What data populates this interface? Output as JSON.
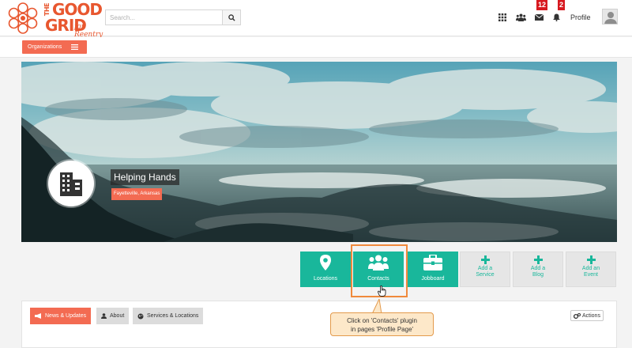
{
  "header": {
    "logo": {
      "line_the": "THE",
      "line_good": "GOOD",
      "line_grid": "GRID",
      "tagline": "for Reentry"
    },
    "search": {
      "placeholder": "Search..."
    },
    "icons": [
      "search-icon",
      "grid-apps-icon",
      "users-icon",
      "envelope-icon",
      "bell-icon"
    ],
    "messages_badge": "12",
    "notifications_badge": "2",
    "profile_label": "Profile"
  },
  "orgbar": {
    "button_label": "Organizations"
  },
  "hero": {
    "org_name": "Helping Hands",
    "org_location": "Fayetteville, Arkansas"
  },
  "plugins": [
    {
      "label": "Locations",
      "icon": "map-marker-icon",
      "style": "green"
    },
    {
      "label": "Contacts",
      "icon": "users-icon",
      "style": "green"
    },
    {
      "label": "Jobboard",
      "icon": "briefcase-icon",
      "style": "green"
    },
    {
      "label_line1": "Add a",
      "label_line2": "Service",
      "icon": "plus-icon",
      "style": "grey"
    },
    {
      "label_line1": "Add a",
      "label_line2": "Blog",
      "icon": "plus-icon",
      "style": "grey"
    },
    {
      "label_line1": "Add an",
      "label_line2": "Event",
      "icon": "plus-icon",
      "style": "grey"
    }
  ],
  "tabs": [
    {
      "label": "News & Updates",
      "icon": "bullhorn-icon",
      "active": true
    },
    {
      "label": "About",
      "icon": "user-icon",
      "active": false
    },
    {
      "label": "Services & Locations",
      "icon": "globe-icon",
      "active": false
    }
  ],
  "actions_label": "Actions",
  "callout": {
    "line1": "Click on 'Contacts' plugin",
    "line2": "in pages 'Profile Page'"
  },
  "colors": {
    "brand_orange": "#f36b52",
    "logo_orange": "#e8572f",
    "plugin_green": "#19b79b",
    "badge_red": "#d71920",
    "highlight_orange": "#f08a3c"
  }
}
